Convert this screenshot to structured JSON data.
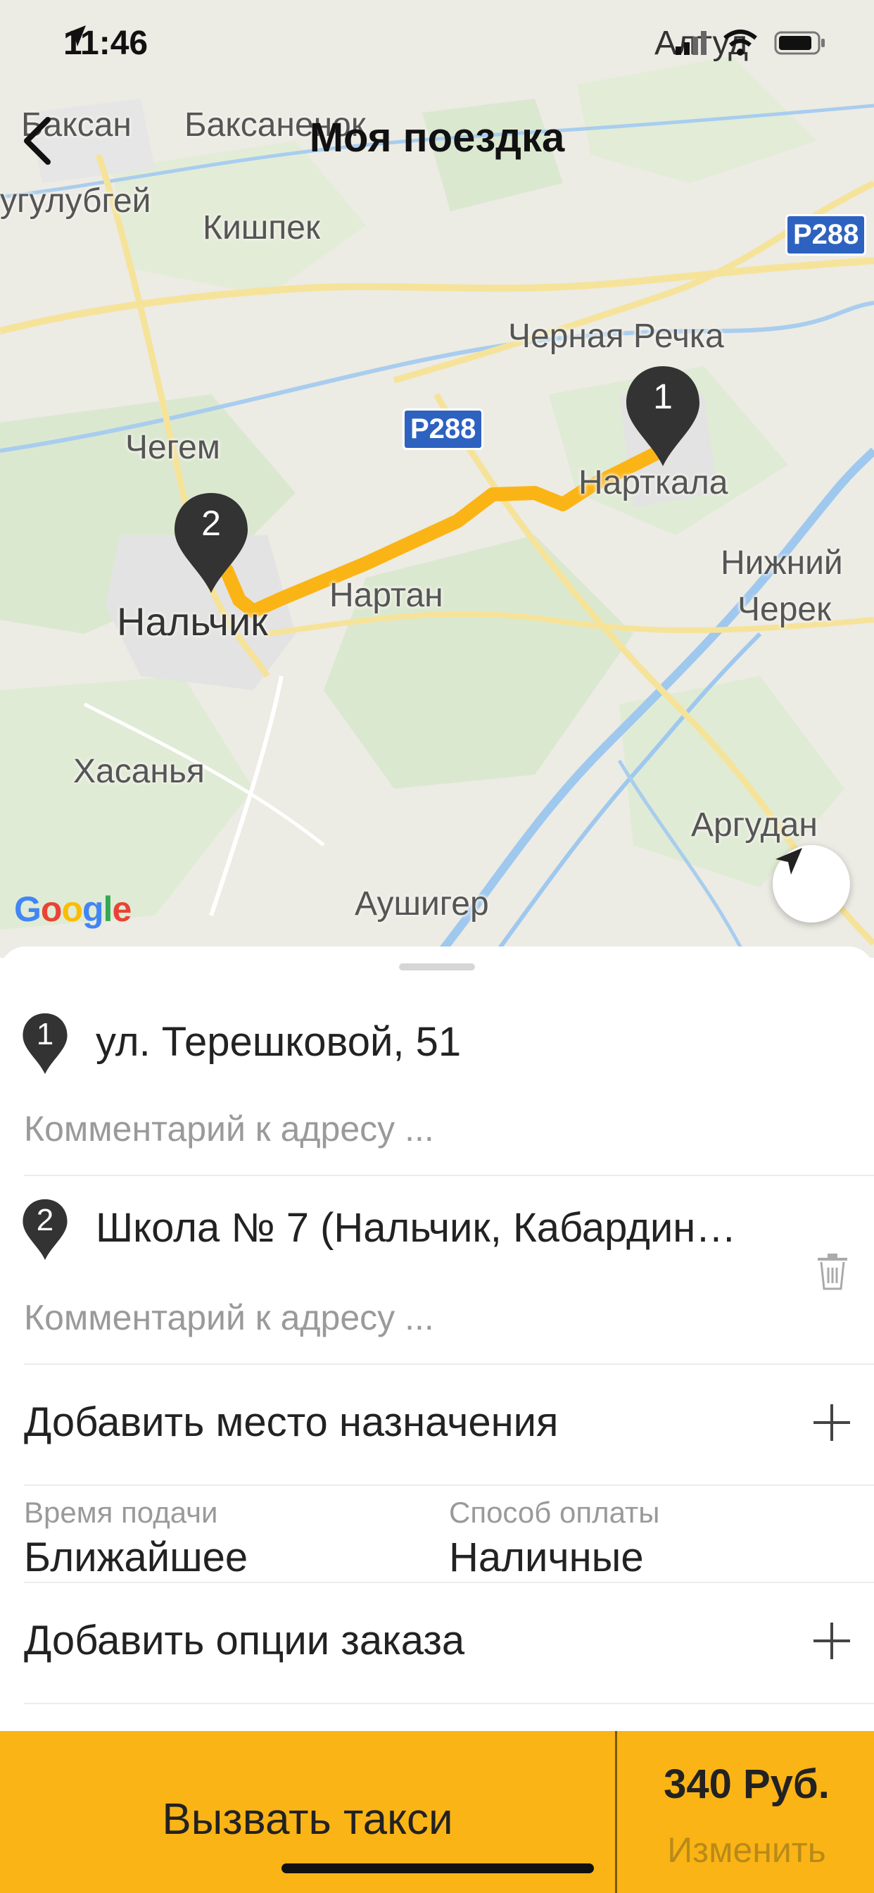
{
  "status_bar": {
    "time": "11:46",
    "carrier": "Алтуд"
  },
  "header": {
    "title": "Моя поездка"
  },
  "map": {
    "labels": {
      "baksan": "Баксан",
      "baksanenok": "Баксаненок",
      "kyzburun": "угулубгей",
      "kishpek": "Кишпек",
      "chernaya": "Черная Речка",
      "chegem": "Чегем",
      "nartkala": "Нарткала",
      "nizhniy": "Нижний",
      "cherek": "Черек",
      "nartan": "Нартан",
      "nalchik": "Нальчик",
      "khasanya": "Хасанья",
      "argudan": "Аргудан",
      "aushiger": "Аушигер"
    },
    "road_shields": {
      "r288_a": "Р288",
      "r288_b": "Р288"
    },
    "pins": {
      "pin1": "1",
      "pin2": "2"
    },
    "google": "Google",
    "route_color": "#fbb415"
  },
  "trip": {
    "stops": [
      {
        "number": "1",
        "address": "ул. Терешковой, 51",
        "comment_placeholder": "Комментарий к адресу ..."
      },
      {
        "number": "2",
        "address": "Школа № 7 (Нальчик, Кабардин…",
        "comment_placeholder": "Комментарий к адресу ..."
      }
    ],
    "add_destination": "Добавить место назначения",
    "pickup_time_label": "Время подачи",
    "pickup_time_value": "Ближайшее",
    "payment_label": "Способ оплаты",
    "payment_value": "Наличные",
    "add_options": "Добавить опции заказа"
  },
  "bottom_bar": {
    "call_label": "Вызвать такси",
    "price": "340 Руб.",
    "change_label": "Изменить"
  },
  "colors": {
    "accent": "#fbb415",
    "pin": "#333333"
  }
}
